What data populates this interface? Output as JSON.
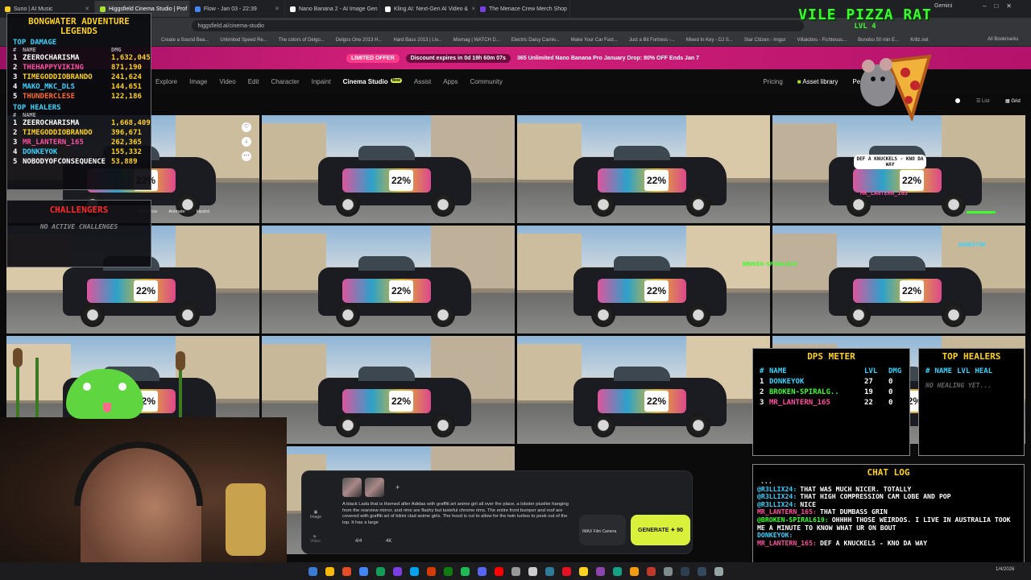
{
  "browser": {
    "tabs": [
      {
        "label": "Suno | AI Music",
        "color": "#ffd21f"
      },
      {
        "label": "Higgsfield Cinema Studio | Prof",
        "color": "#a6e22e",
        "active": true
      },
      {
        "label": "Flow - Jan 03 - 22:39",
        "color": "#4285f4"
      },
      {
        "label": "Nano Banana 2 - AI Image Gen",
        "color": "#ffffff"
      },
      {
        "label": "Kling AI: Next-Gen AI Video &",
        "color": "#ffffff"
      },
      {
        "label": "The Menace Crew Merch Shop",
        "color": "#7b3fe4"
      }
    ],
    "profile_label": "Gemini",
    "url": "higgsfield.ai/cinema-studio",
    "bookmarks": [
      "Create a Sound Bea...",
      "Unlimited Speed Re...",
      "The colors of Delgo...",
      "Delgos One 2013 H...",
      "Hard Bass 2013 | Liv...",
      "Mixmag | WATCH D...",
      "Electric Daisy Carniv...",
      "Make Your Car Fast...",
      "Just a Bit Fortress -...",
      "Mixed In Key - DJ S...",
      "Star Citizen - Imgur",
      "Villalobos - Fichtesus...",
      "Bonobo 50 min E...",
      "Kr8z.net"
    ],
    "all_bookmarks": "All Bookmarks"
  },
  "promo": {
    "limited": "LIMITED OFFER",
    "discount": "Discount expires in 0d 19h 60m 07s",
    "text": "365 Unlimited Nano Banana Pro January Drop: 80% OFF Ends Jan 7"
  },
  "nav": {
    "items": [
      "Explore",
      "Image",
      "Video",
      "Edit",
      "Character",
      "Inpaint",
      "Cinema Studio",
      "Assist",
      "Apps",
      "Community"
    ],
    "new_badge": "New",
    "pricing": "Pricing",
    "asset_library": "Asset library",
    "personal": "Personal",
    "list": "List",
    "grid": "Grid"
  },
  "tile_actions": {
    "reference": "Reference",
    "animate": "Animate",
    "inpaint": "Inpaint"
  },
  "car_number": "22%",
  "leaderboard": {
    "title": "BONGWATER ADVENTURE LEGENDS",
    "damage_title": "TOP DAMAGE",
    "col_hash": "#",
    "col_name": "NAME",
    "col_dmg": "DMG",
    "damage": [
      {
        "rank": "1",
        "name": "ZEEROCHARISMA",
        "value": "1,632,045",
        "color": "#ffffff"
      },
      {
        "rank": "2",
        "name": "THEHAPPYVIKING",
        "value": "871,190",
        "color": "#ff4fa0"
      },
      {
        "rank": "3",
        "name": "TIMEGODDIOBRANDO",
        "value": "241,624",
        "color": "#ffd21f"
      },
      {
        "rank": "4",
        "name": "MAKO_MKC_DLS",
        "value": "144,651",
        "color": "#3ad3ff"
      },
      {
        "rank": "5",
        "name": "THUNDERCLESE",
        "value": "122,186",
        "color": "#ff6b2d"
      }
    ],
    "healers_title": "TOP HEALERS",
    "healers": [
      {
        "rank": "1",
        "name": "ZEEROCHARISMA",
        "value": "1,668,409",
        "color": "#ffffff"
      },
      {
        "rank": "2",
        "name": "TIMEGODDIOBRANDO",
        "value": "396,671",
        "color": "#ffd21f"
      },
      {
        "rank": "3",
        "name": "MR_LANTERN_165",
        "value": "262,365",
        "color": "#ff4fa0"
      },
      {
        "rank": "4",
        "name": "DONKEYOK",
        "value": "155,332",
        "color": "#3ad3ff"
      },
      {
        "rank": "5",
        "name": "NOBODYOFCONSEQUENCE",
        "value": "53,889",
        "color": "#ffffff"
      }
    ]
  },
  "challengers": {
    "title": "CHALLENGERS",
    "empty": "NO ACTIVE CHALLENGES"
  },
  "vile": {
    "title": "VILE PIZZA RAT",
    "level": "LVL 4"
  },
  "overlays": {
    "bubble": "DEF A KNUCKELS - KNO DA WAY",
    "name1": "MR_LANTERN_165",
    "name2": "BROKEN-SPIRAL619",
    "name3": "DONKEYOK"
  },
  "dps": {
    "title": "DPS METER",
    "cols": [
      "#",
      "NAME",
      "LVL",
      "DMG"
    ],
    "rows": [
      {
        "rank": "1",
        "name": "DONKEYOK",
        "lvl": "27",
        "dmg": "0",
        "color": "#3ad3ff"
      },
      {
        "rank": "2",
        "name": "BROKEN-SPIRALG..",
        "lvl": "19",
        "dmg": "0",
        "color": "#39ff2a"
      },
      {
        "rank": "3",
        "name": "MR_LANTERN_165",
        "lvl": "22",
        "dmg": "0",
        "color": "#ff4fa0"
      }
    ]
  },
  "top_healers": {
    "title": "TOP HEALERS",
    "cols": [
      "#",
      "NAME",
      "LVL",
      "HEAL"
    ],
    "empty": "NO HEALING YET..."
  },
  "chat": {
    "title": "CHAT LOG",
    "lines": [
      {
        "user": "",
        "text": "...",
        "color": "#ffffff"
      },
      {
        "user": "@R3LLIX24:",
        "text": "THAT WAS MUCH NICER. TOTALLY",
        "color": "#3ad3ff"
      },
      {
        "user": "@R3LLIX24:",
        "text": "THAT HIGH COMPRESSION CAM LOBE AND POP",
        "color": "#3ad3ff"
      },
      {
        "user": "@R3LLIX24:",
        "text": "NICE",
        "color": "#3ad3ff"
      },
      {
        "user": "MR_LANTERN_165:",
        "text": "THAT DUMBASS GRIN",
        "color": "#ff4fa0"
      },
      {
        "user": "@BROKEN-SPIRAL619:",
        "text": "OHHHH THOSE WEIRDOS. I LIVE IN AUSTRALIA TOOK ME A MINUTE TO KNOW WHAT UR ON BOUT",
        "color": "#39ff2a"
      },
      {
        "user": "DONKEYOK:",
        "text": "",
        "color": "#3ad3ff"
      },
      {
        "user": "MR_LANTERN_165:",
        "text": "DEF A KNUCKELS - KNO DA WAY",
        "color": "#ff4fa0"
      }
    ]
  },
  "prompt": {
    "text": "A black Lada that is themed after Adidas with graffiti art anime girl all over the place, a lobster plushie hanging from the rearview mirror, and rims are flashy but tasteful chrome rims. The entire front bumper and roof are covered with graffiti art of bikini clad anime girls. The hood is cut to allow for the twin turbos to peek out of the top. It has a large",
    "count": "4/4",
    "res": "4K",
    "mode_image": "Image",
    "mode_video": "Video",
    "camera": "IMAX Film Camera",
    "generate": "GENERATE ✦ 90",
    "add": "+"
  },
  "clock": "1/4/2026"
}
